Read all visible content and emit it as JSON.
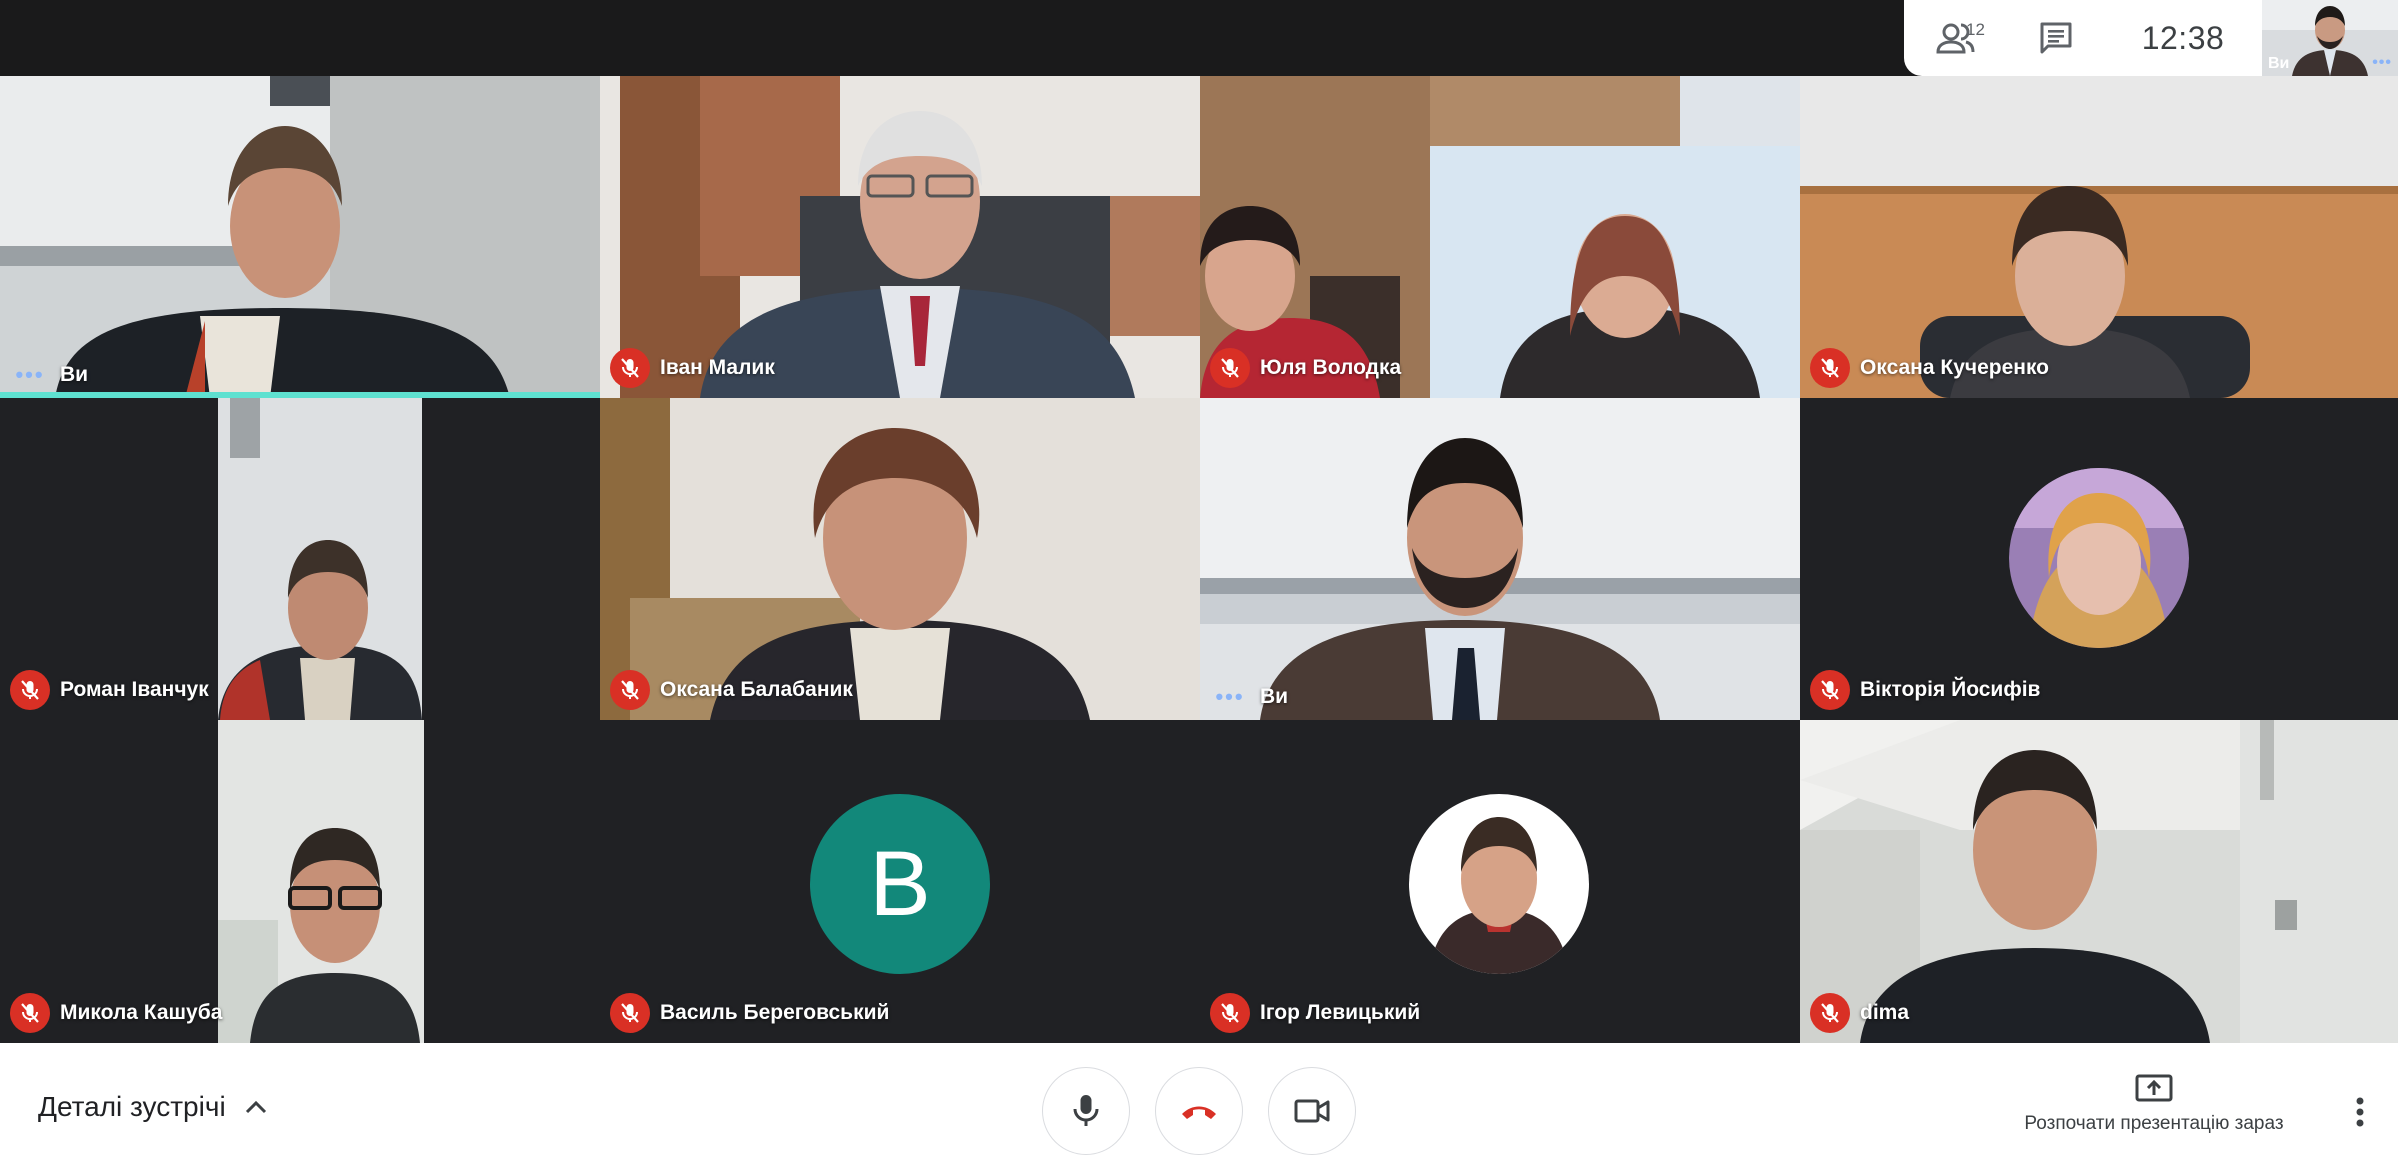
{
  "topbar": {
    "people_count": "12",
    "clock": "12:38",
    "self_thumb_label": "Ви",
    "self_thumb_dots": "•••"
  },
  "tiles": [
    {
      "name": "Ви",
      "indicator": "dots"
    },
    {
      "name": "Іван Малик",
      "indicator": "muted"
    },
    {
      "name": "Юля Володка",
      "indicator": "muted"
    },
    {
      "name": "Оксана Кучеренко",
      "indicator": "muted"
    },
    {
      "name": "Роман Іванчук",
      "indicator": "muted"
    },
    {
      "name": "Оксана Балабаник",
      "indicator": "muted"
    },
    {
      "name": "Ви",
      "indicator": "dots"
    },
    {
      "name": "Вікторія Йосифів",
      "indicator": "muted"
    },
    {
      "name": "Микола Кашуба",
      "indicator": "muted"
    },
    {
      "name": "Василь Береговський",
      "indicator": "muted",
      "avatar_letter": "B",
      "avatar_color": "#12887a"
    },
    {
      "name": "Ігор Левицький",
      "indicator": "muted"
    },
    {
      "name": "dima",
      "indicator": "muted"
    }
  ],
  "dots_glyph": "•••",
  "bottombar": {
    "details_label": "Деталі зустрічі",
    "present_label": "Розпочати презентацію зараз"
  },
  "colors": {
    "mute_badge": "#d93025",
    "active_speaker": "#5ee1d0",
    "end_call_icon": "#d93025"
  }
}
